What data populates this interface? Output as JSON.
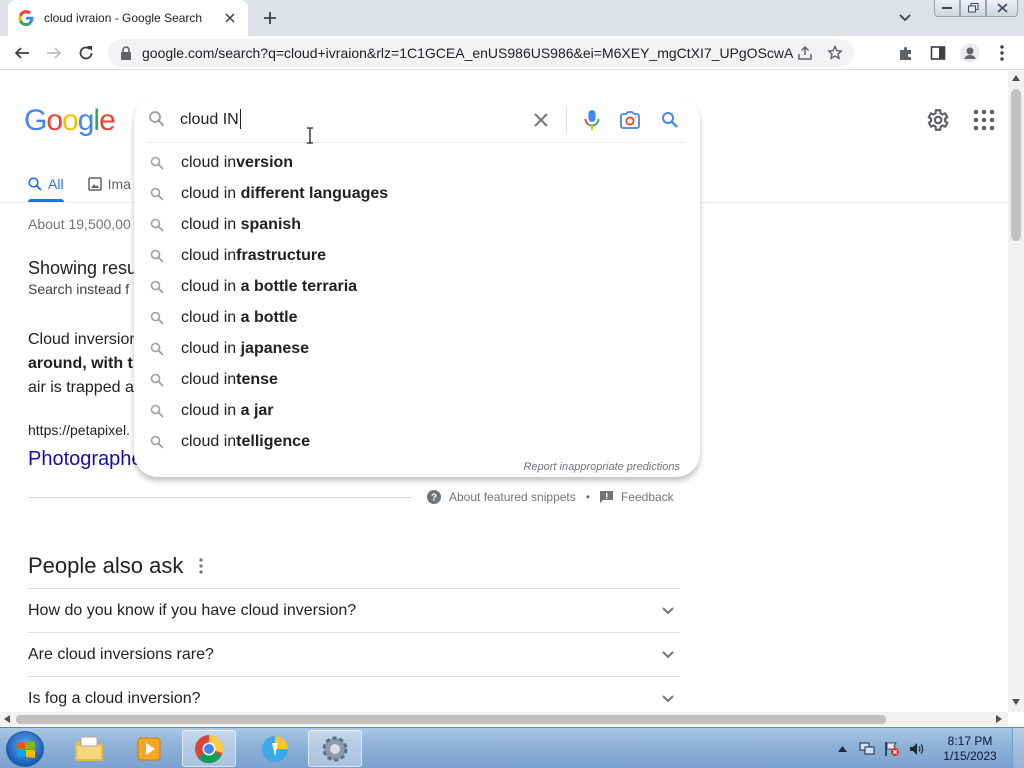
{
  "browser": {
    "tab_title": "cloud ivraion - Google Search",
    "url": "google.com/search?q=cloud+ivraion&rlz=1C1GCEA_enUS986US986&ei=M6XEY_mgCtXI7_UPgOScwAs&ve..."
  },
  "google": {
    "logo_letters": [
      "G",
      "o",
      "o",
      "g",
      "l",
      "e"
    ],
    "search_value": "cloud IN",
    "tabs": {
      "all": "All",
      "images": "Ima"
    },
    "result_stats": "About 19,500,00",
    "showing_results": "Showing resu",
    "search_instead": "Search instead f",
    "snippet_line1": "Cloud inversion",
    "snippet_line2": "around, with th",
    "snippet_line3": "air is trapped a",
    "snippet_url": "https://petapixel.",
    "snippet_title": "Photographe",
    "about_snippets": "About featured snippets",
    "feedback": "Feedback",
    "paa_title": "People also ask",
    "paa_questions": [
      "How do you know if you have cloud inversion?",
      "Are cloud inversions rare?",
      "Is fog a cloud inversion?"
    ]
  },
  "suggestions": [
    {
      "prefix": "cloud in",
      "bold": "version"
    },
    {
      "prefix": "cloud in ",
      "bold": "different languages"
    },
    {
      "prefix": "cloud in ",
      "bold": "spanish"
    },
    {
      "prefix": "cloud in",
      "bold": "frastructure"
    },
    {
      "prefix": "cloud in ",
      "bold": "a bottle terraria"
    },
    {
      "prefix": "cloud in ",
      "bold": "a bottle"
    },
    {
      "prefix": "cloud in ",
      "bold": "japanese"
    },
    {
      "prefix": "cloud in",
      "bold": "tense"
    },
    {
      "prefix": "cloud in ",
      "bold": "a jar"
    },
    {
      "prefix": "cloud in",
      "bold": "telligence"
    }
  ],
  "report_predictions": "Report inappropriate predictions",
  "taskbar": {
    "time": "8:17 PM",
    "date": "1/15/2023"
  },
  "colors": {
    "accent": "#1a73e8",
    "link": "#1a0dab",
    "mic_blue": "#4285f4"
  }
}
